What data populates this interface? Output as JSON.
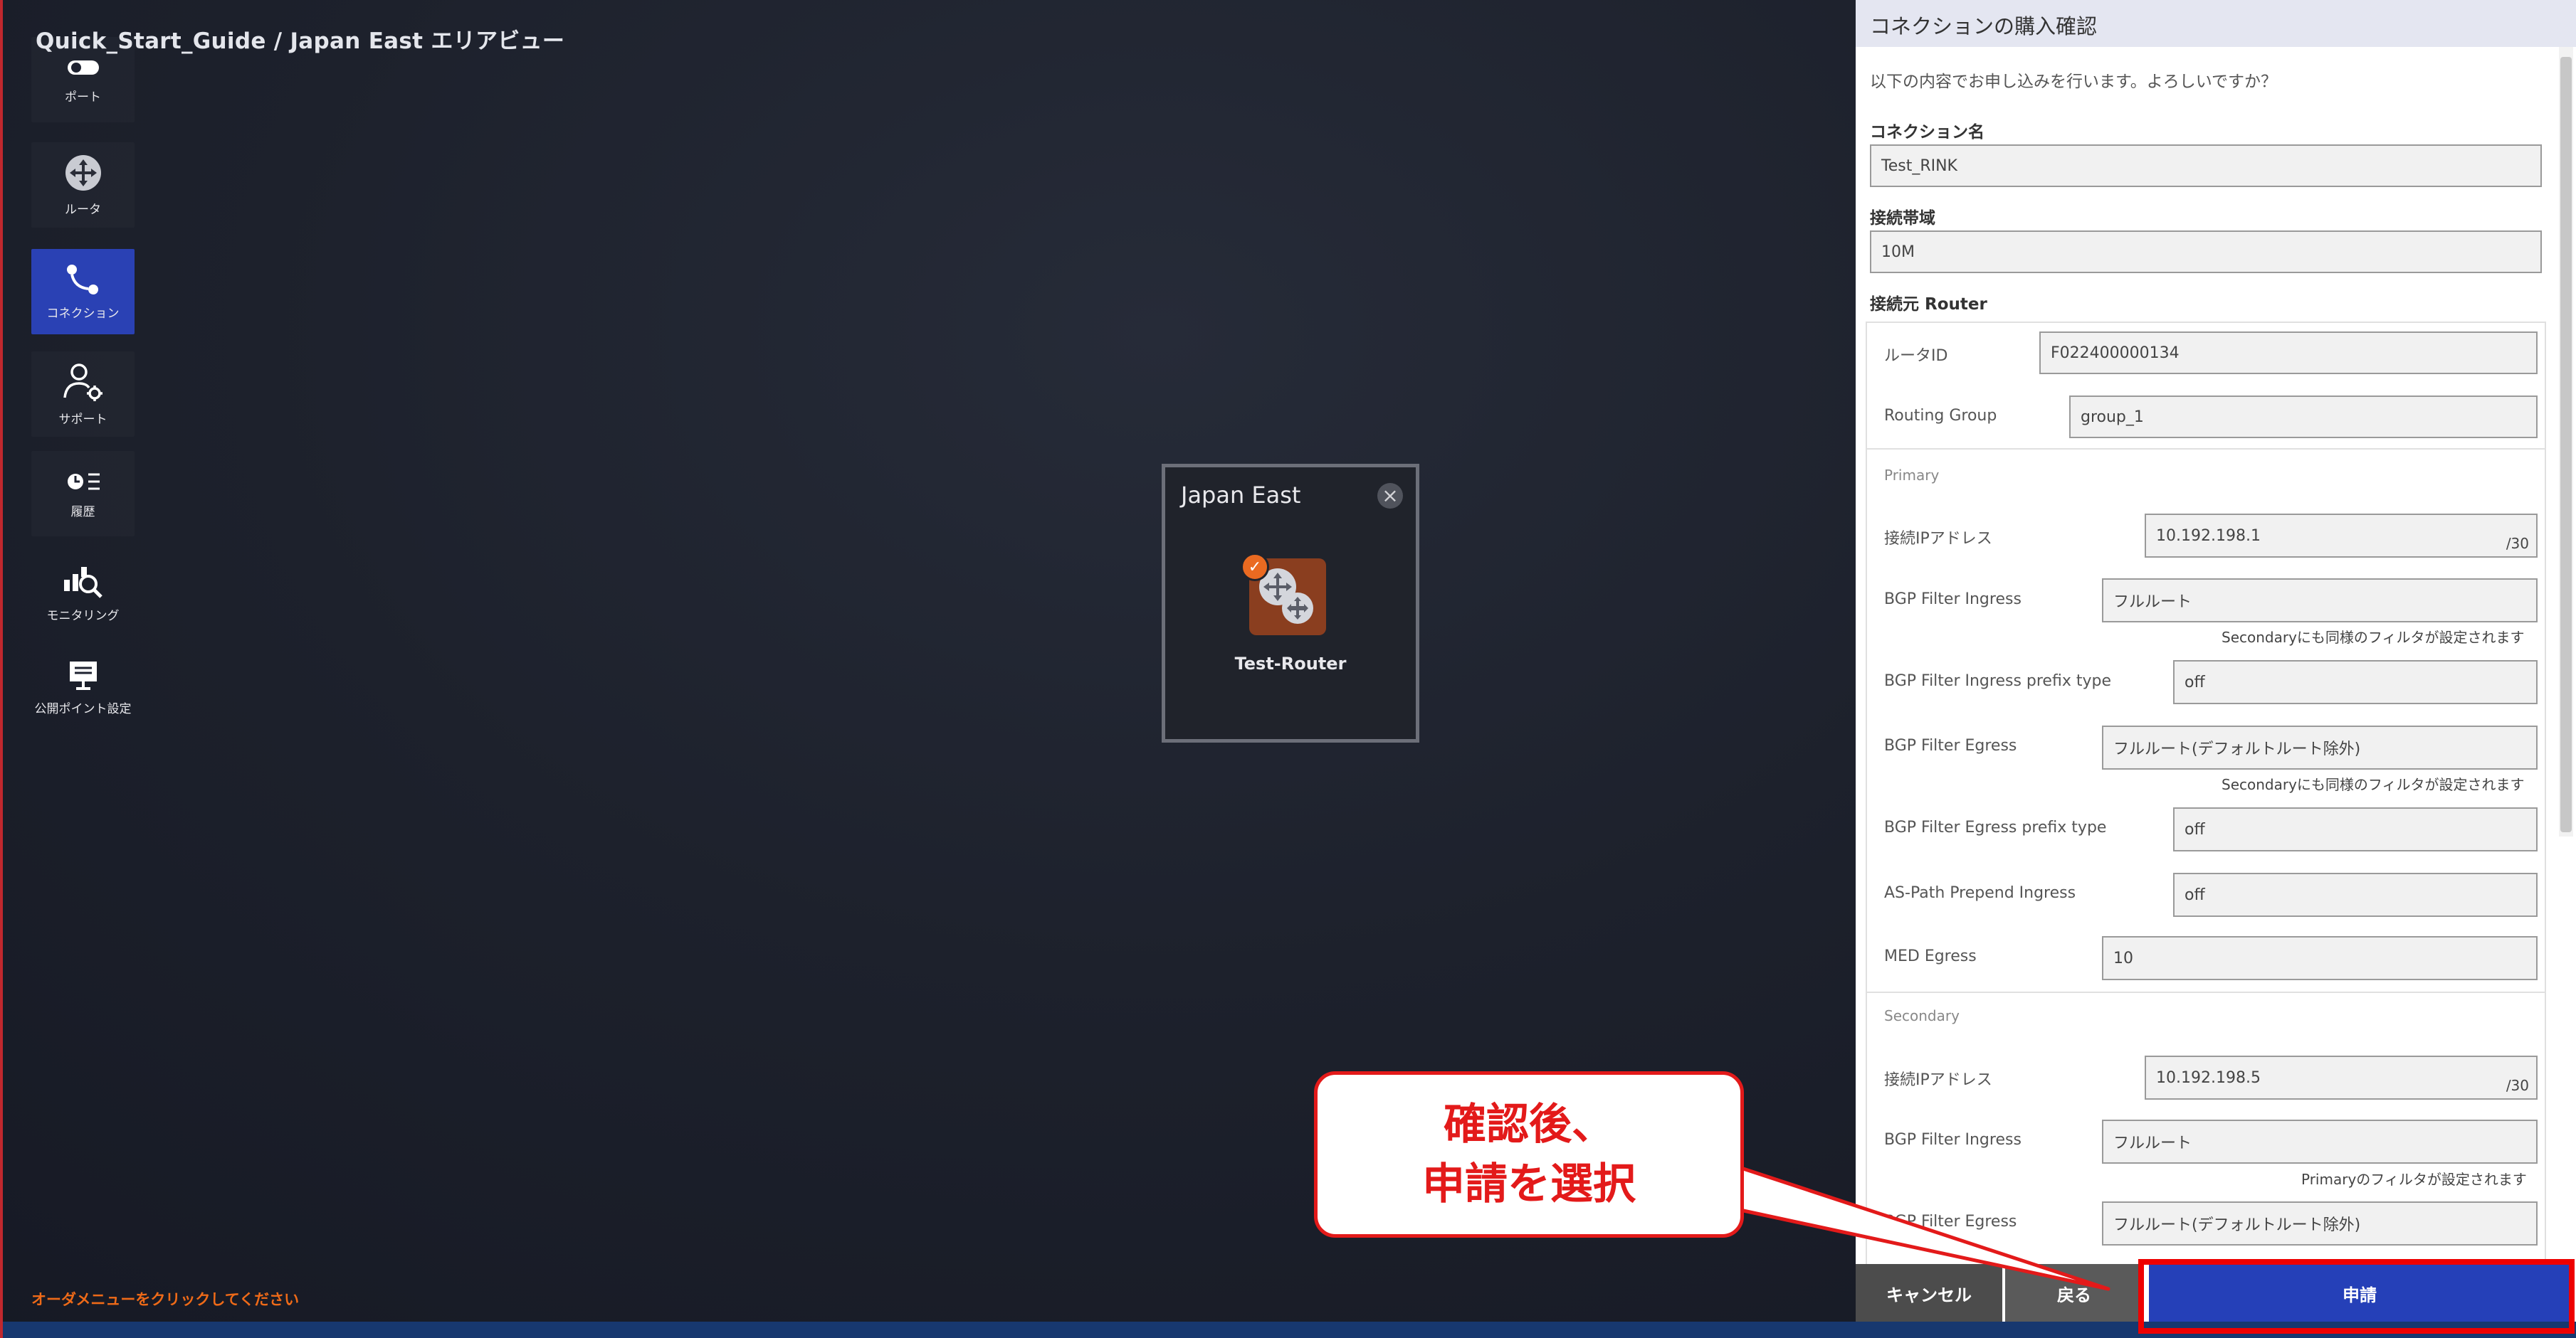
{
  "breadcrumb": "Quick_Start_Guide / Japan East エリアビュー",
  "sidebar": {
    "items": [
      {
        "label": "ポート",
        "icon": "port-icon",
        "active": false
      },
      {
        "label": "ルータ",
        "icon": "router-icon",
        "active": false
      },
      {
        "label": "コネクション",
        "icon": "connection-icon",
        "active": true
      },
      {
        "label": "サポート",
        "icon": "support-icon",
        "active": false
      },
      {
        "label": "履歴",
        "icon": "history-icon",
        "active": false
      },
      {
        "label": "モニタリング",
        "icon": "monitoring-icon",
        "active": false
      },
      {
        "label": "公開ポイント設定",
        "icon": "public-point-icon",
        "active": false
      }
    ]
  },
  "order_hint": "オーダメニューをクリックしてください",
  "area": {
    "title": "Japan East",
    "close_icon": "close-icon",
    "router": {
      "label": "Test-Router",
      "icon": "router-icon",
      "badge": "check-icon"
    }
  },
  "panel": {
    "title": "コネクションの購入確認",
    "question": "以下の内容でお申し込みを行います。よろしいですか？",
    "connection_name": {
      "label": "コネクション名",
      "value": "Test_RINK"
    },
    "bandwidth": {
      "label": "接続帯域",
      "value": "10M"
    },
    "source_router": {
      "label": "接続元 Router",
      "router_id": {
        "label": "ルータID",
        "value": "F022400000134"
      },
      "routing_group": {
        "label": "Routing Group",
        "value": "group_1"
      }
    },
    "primary": {
      "caption": "Primary",
      "ip": {
        "label": "接続IPアドレス",
        "value": "10.192.198.1",
        "suffix": "/30"
      },
      "filter_ingress": {
        "label": "BGP Filter Ingress",
        "value": "フルルート",
        "note": "Secondaryにも同様のフィルタが設定されます"
      },
      "filter_ingress_prefix": {
        "label": "BGP Filter Ingress prefix type",
        "value": "off"
      },
      "filter_egress": {
        "label": "BGP Filter Egress",
        "value": "フルルート(デフォルトルート除外)",
        "note": "Secondaryにも同様のフィルタが設定されます"
      },
      "filter_egress_prefix": {
        "label": "BGP Filter Egress prefix type",
        "value": "off"
      },
      "as_path": {
        "label": "AS-Path Prepend Ingress",
        "value": "off"
      },
      "med": {
        "label": "MED Egress",
        "value": "10"
      }
    },
    "secondary": {
      "caption": "Secondary",
      "ip": {
        "label": "接続IPアドレス",
        "value": "10.192.198.5",
        "suffix": "/30"
      },
      "filter_ingress": {
        "label": "BGP Filter Ingress",
        "value": "フルルート",
        "note": "Primaryのフィルタが設定されます"
      },
      "filter_egress": {
        "label": "BGP Filter Egress",
        "value": "フルルート(デフォルトルート除外)"
      }
    },
    "buttons": {
      "cancel": "キャンセル",
      "back": "戻る",
      "submit": "申請"
    }
  },
  "callout": {
    "line1": "確認後、",
    "line2": "申請を選択"
  },
  "colors": {
    "accent": "#2a41b4",
    "submit": "#2540b8",
    "annotation": "#e31a1a",
    "hint": "#ee6a18",
    "router": "#8a3e1f"
  }
}
